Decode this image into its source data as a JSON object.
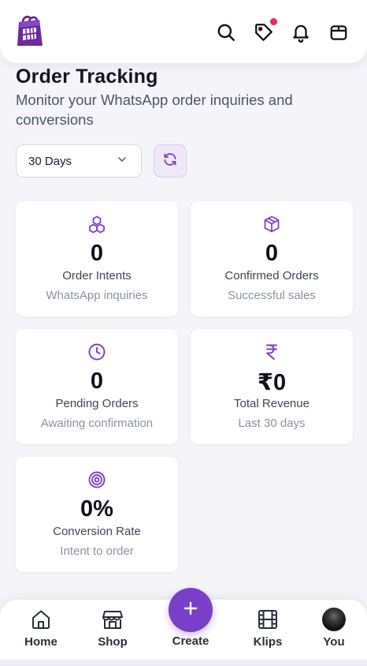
{
  "header": {
    "logo": "shopping-bag-logo",
    "icons": [
      "search-icon",
      "tag-icon",
      "bell-icon",
      "package-icon"
    ],
    "notification_dot_color": "#f0245c"
  },
  "page": {
    "title": "Order Tracking",
    "subtitle": "Monitor your WhatsApp order inquiries and conversions"
  },
  "controls": {
    "range_selected": "30 Days",
    "refresh_icon": "refresh-icon"
  },
  "stats": [
    {
      "icon": "boxes-icon",
      "value": "0",
      "label": "Order Intents",
      "sub": "WhatsApp inquiries"
    },
    {
      "icon": "package-icon",
      "value": "0",
      "label": "Confirmed Orders",
      "sub": "Successful sales"
    },
    {
      "icon": "clock-icon",
      "value": "0",
      "label": "Pending Orders",
      "sub": "Awaiting confirmation"
    },
    {
      "icon": "rupee-icon",
      "value": "₹0",
      "label": "Total Revenue",
      "sub": "Last 30 days"
    },
    {
      "icon": "target-icon",
      "value": "0%",
      "label": "Conversion Rate",
      "sub": "Intent to order"
    }
  ],
  "nav": {
    "items": [
      {
        "label": "Home",
        "icon": "home-icon"
      },
      {
        "label": "Shop",
        "icon": "store-icon"
      },
      {
        "label": "Create",
        "icon": "plus-icon"
      },
      {
        "label": "Klips",
        "icon": "film-icon"
      },
      {
        "label": "You",
        "icon": "avatar"
      }
    ]
  },
  "colors": {
    "accent": "#7a3fc8",
    "icon_purple": "#7b3fc4",
    "background": "#f5f5f9"
  }
}
